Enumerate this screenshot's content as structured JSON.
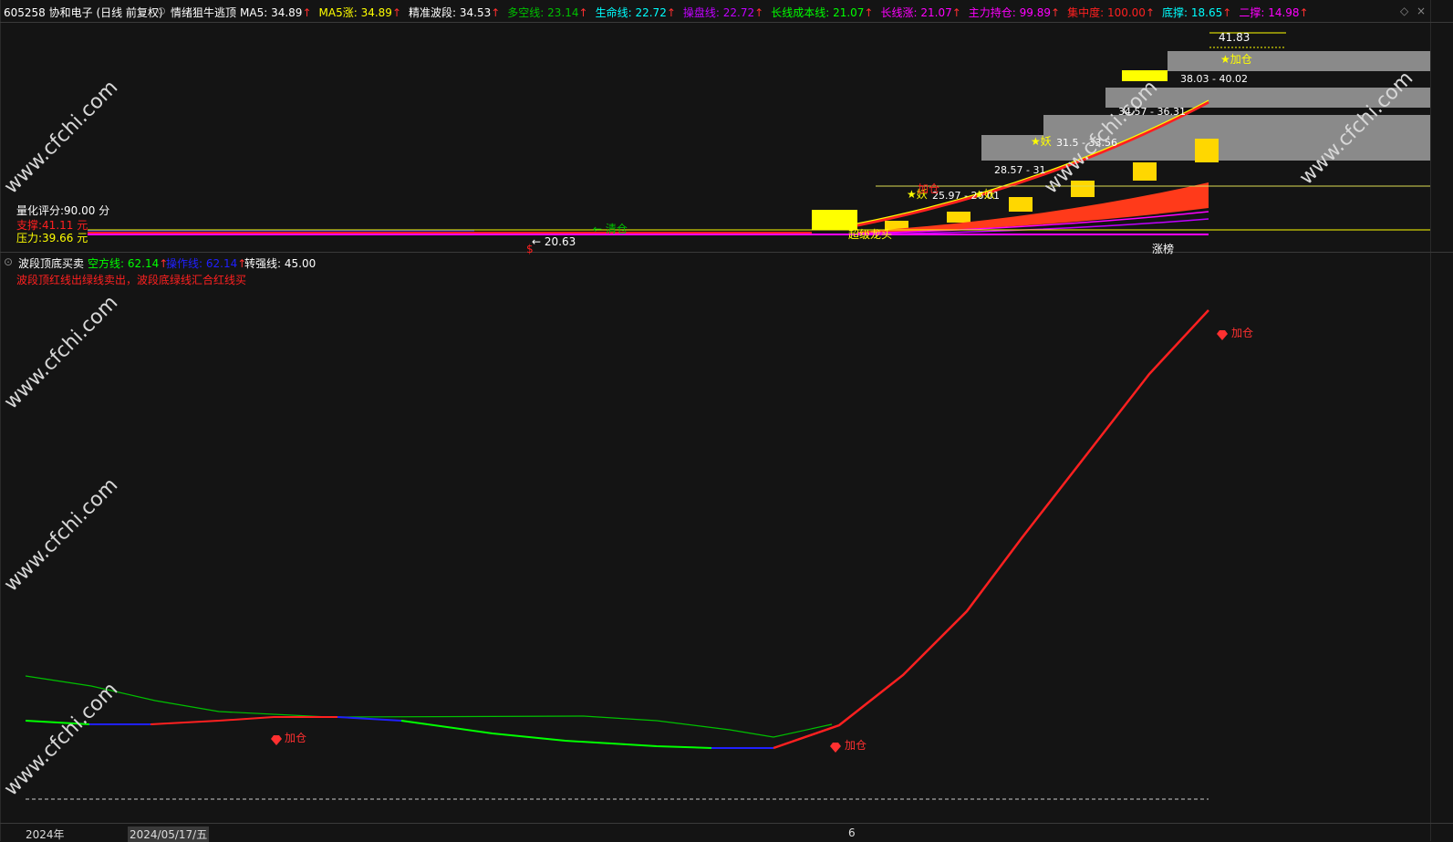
{
  "header": {
    "stock": "605258 协和电子 (日线 前复权)",
    "indicator_name": "情绪狙牛逃顶",
    "items": [
      {
        "label": "MA5:",
        "value": "34.89",
        "color": "#ffffff"
      },
      {
        "label": "MA5涨:",
        "value": "34.89",
        "color": "#ffff00"
      },
      {
        "label": "精准波段:",
        "value": "34.53",
        "color": "#ffffff"
      },
      {
        "label": "多空线:",
        "value": "23.14",
        "color": "#00c000"
      },
      {
        "label": "生命线:",
        "value": "22.72",
        "color": "#00ffff"
      },
      {
        "label": "操盘线:",
        "value": "22.72",
        "color": "#c000ff"
      },
      {
        "label": "长线成本线:",
        "value": "21.07",
        "color": "#00ff00"
      },
      {
        "label": "长线涨:",
        "value": "21.07",
        "color": "#ff00ff"
      },
      {
        "label": "主力持仓:",
        "value": "99.89",
        "color": "#ff00ff"
      },
      {
        "label": "集中度:",
        "value": "100.00",
        "color": "#ff2020"
      },
      {
        "label": "底撑:",
        "value": "18.65",
        "color": "#00ffff"
      },
      {
        "label": "二撑:",
        "value": "14.98",
        "color": "#ff00ff"
      }
    ]
  },
  "main_panel": {
    "score": "量化评分:90.00 分",
    "support": "支撑:41.11 元",
    "pressure": "压力:39.66 元",
    "price_low": "20.63",
    "price_high": "41.83",
    "qingcang": "清仓",
    "dollar": "$",
    "zhangting": "涨榜",
    "chaosu": "超级龙头",
    "ranges": [
      {
        "text": "25.97 - 26.01"
      },
      {
        "text": "28.57 - 31"
      },
      {
        "text": "31.5 - 33.56"
      },
      {
        "text": "34.57 - 36.31"
      },
      {
        "text": "38.03 - 40.02"
      }
    ],
    "tags": {
      "yao": "★妖",
      "jiacang": "★加仓",
      "jiacang_plain": "加仓"
    }
  },
  "sub_panel": {
    "title": "波段顶底买卖",
    "kongfang_label": "空方线:",
    "kongfang_value": "62.14",
    "caozuo_label": "操作线:",
    "caozuo_value": "62.14",
    "zhuanqiang_label": "转强线:",
    "zhuanqiang_value": "45.00",
    "note": "波段顶红线出绿线卖出，波段底绿线汇合红线买",
    "markers": [
      "加仓",
      "加仓",
      "加仓"
    ]
  },
  "footer": {
    "year": "2024年",
    "date": "2024/05/17/五",
    "month": "6"
  },
  "watermark": "www.cfchi.com",
  "colors": {
    "bg": "#141414",
    "red": "#ff2020",
    "green": "#00ff00",
    "yellow": "#ffff00",
    "gray": "#8a8a8a",
    "blue": "#2020ff"
  }
}
